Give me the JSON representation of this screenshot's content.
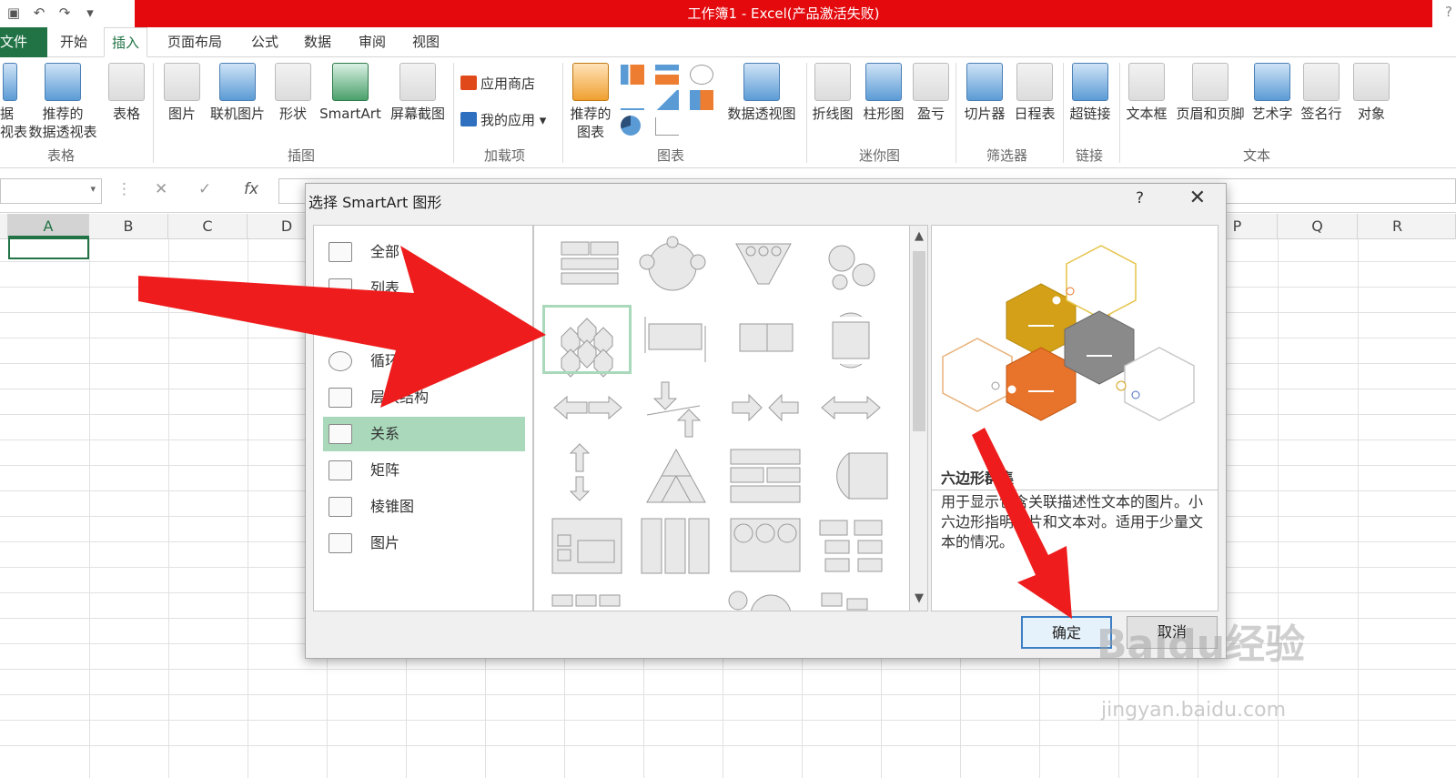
{
  "window": {
    "title": "工作簿1 -  Excel(产品激活失败)",
    "help": "?"
  },
  "tabs": [
    "文件",
    "开始",
    "插入",
    "页面布局",
    "公式",
    "数据",
    "审阅",
    "视图"
  ],
  "ribbon": {
    "buttons": {
      "pivot_partial": "据\n视表",
      "recommended_pivot": "推荐的\n数据透视表",
      "table": "表格",
      "picture": "图片",
      "online_picture": "联机图片",
      "shapes": "形状",
      "smartart": "SmartArt",
      "screenshot": "屏幕截图",
      "store": "应用商店",
      "my_apps": "我的应用",
      "recommended_charts": "推荐的\n图表",
      "pivot_chart": "数据透视图",
      "line_spark": "折线图",
      "column_spark": "柱形图",
      "winloss": "盈亏",
      "slicer": "切片器",
      "timeline": "日程表",
      "hyperlink": "超链接",
      "textbox": "文本框",
      "header_footer": "页眉和页脚",
      "wordart": "艺术字",
      "signature": "签名行",
      "object": "对象"
    },
    "groups": {
      "tables": "表格",
      "illustrations": "插图",
      "addins": "加载项",
      "charts": "图表",
      "sparklines": "迷你图",
      "filters": "筛选器",
      "links": "链接",
      "text": "文本"
    }
  },
  "formula_bar": {
    "cancel": "✕",
    "enter": "✓",
    "fx": "fx"
  },
  "columns": [
    "A",
    "B",
    "C",
    "D",
    "P",
    "Q",
    "R"
  ],
  "dialog": {
    "title": "选择 SmartArt 图形",
    "help": "?",
    "close": "✕",
    "categories": [
      "全部",
      "列表",
      "流程",
      "循环",
      "层次结构",
      "关系",
      "矩阵",
      "棱锥图",
      "图片"
    ],
    "active_category": "关系",
    "preview_name": "六边形群集",
    "preview_desc": "用于显示包含关联描述性文本的图片。小六边形指明图片和文本对。适用于少量文本的情况。",
    "ok": "确定",
    "cancel": "取消"
  },
  "watermark": {
    "brand": "Baidu经验",
    "url": "jingyan.baidu.com"
  },
  "colors": {
    "excel_green": "#217346",
    "title_red": "#e4090d",
    "selection": "#a9d8bb",
    "arrow": "#ee1c1c",
    "hex_gold": "#d4a017",
    "hex_gray": "#8a8a8a",
    "hex_orange": "#e8732a"
  }
}
